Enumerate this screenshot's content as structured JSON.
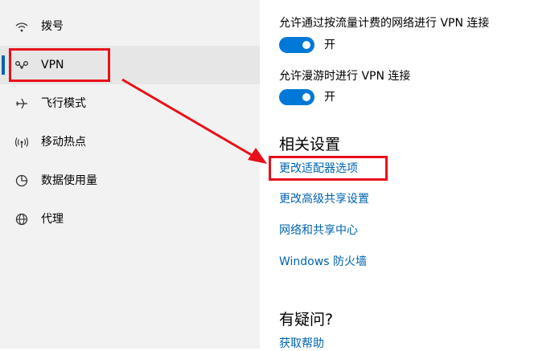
{
  "sidebar": {
    "items": [
      {
        "label": "拨号",
        "icon": "dialup-icon"
      },
      {
        "label": "VPN",
        "icon": "vpn-icon",
        "selected": true
      },
      {
        "label": "飞行模式",
        "icon": "airplane-icon"
      },
      {
        "label": "移动热点",
        "icon": "hotspot-icon"
      },
      {
        "label": "数据使用量",
        "icon": "data-usage-icon"
      },
      {
        "label": "代理",
        "icon": "globe-icon"
      }
    ]
  },
  "main": {
    "metered": {
      "label": "允许通过按流量计费的网络进行 VPN 连接",
      "state": "开",
      "on": true
    },
    "roaming": {
      "label": "允许漫游时进行 VPN 连接",
      "state": "开",
      "on": true
    },
    "related": {
      "title": "相关设置",
      "links": [
        "更改适配器选项",
        "更改高级共享设置",
        "网络和共享中心",
        "Windows 防火墙"
      ]
    },
    "question": {
      "title": "有疑问?",
      "link": "获取帮助"
    }
  },
  "colors": {
    "accent": "#0078d7",
    "link": "#0063b1",
    "annotation": "#e8101a",
    "sidebar_bg": "#f2f2f2"
  }
}
